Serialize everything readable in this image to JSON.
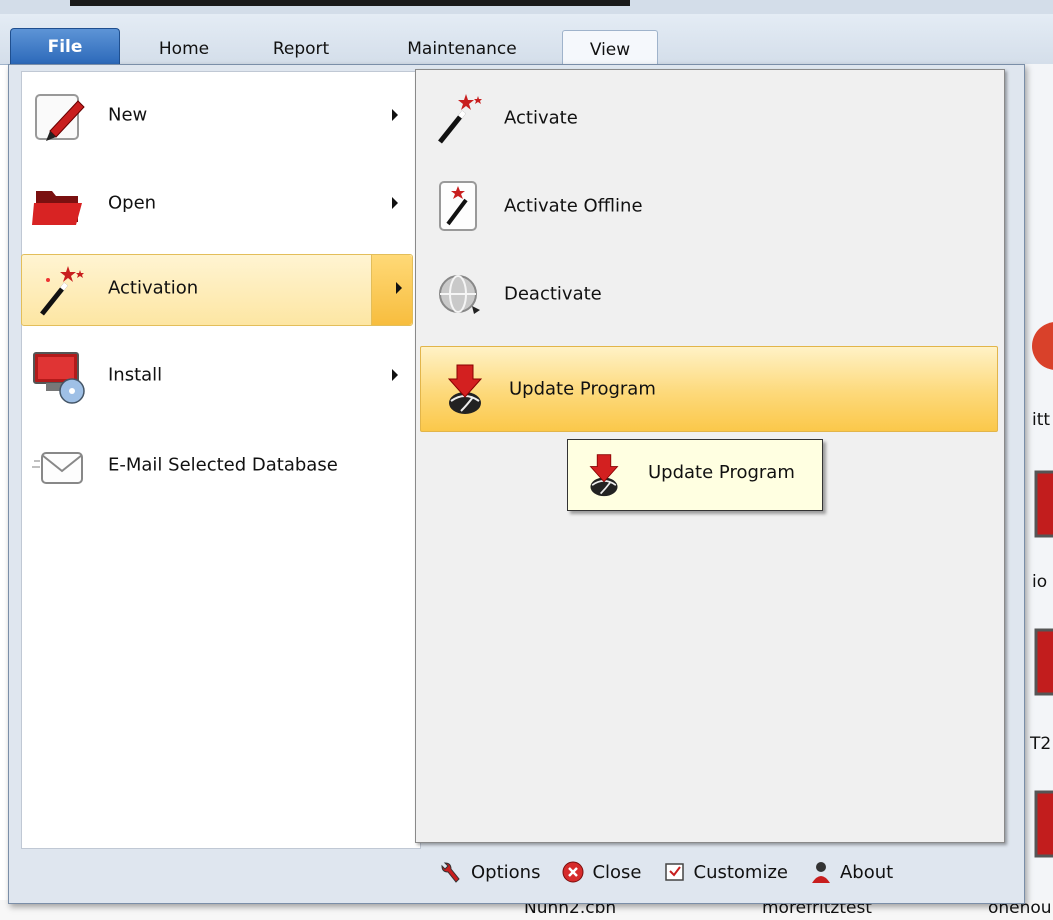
{
  "ribbon": {
    "tabs": [
      {
        "label": "File"
      },
      {
        "label": "Home"
      },
      {
        "label": "Report"
      },
      {
        "label": "Maintenance"
      },
      {
        "label": "View"
      }
    ]
  },
  "file_menu": {
    "left_items": [
      {
        "label": "New",
        "icon": "pencil-icon",
        "has_submenu": true
      },
      {
        "label": "Open",
        "icon": "folder-open-icon",
        "has_submenu": true
      },
      {
        "label": "Activation",
        "icon": "magic-wand-icon",
        "has_submenu": true,
        "active": true
      },
      {
        "label": "Install",
        "icon": "install-disc-icon",
        "has_submenu": true
      },
      {
        "label": "E-Mail Selected Database",
        "icon": "envelope-icon",
        "has_submenu": false
      }
    ],
    "submenu_items": [
      {
        "label": "Activate",
        "icon": "magic-wand-icon"
      },
      {
        "label": "Activate Offline",
        "icon": "wand-card-icon"
      },
      {
        "label": "Deactivate",
        "icon": "globe-gray-icon"
      },
      {
        "label": "Update Program",
        "icon": "update-download-icon",
        "active": true
      }
    ],
    "tooltip": {
      "label": "Update Program",
      "icon": "update-download-icon"
    },
    "footer_buttons": [
      {
        "label": "Options",
        "icon": "wrench-icon"
      },
      {
        "label": "Close",
        "icon": "close-red-icon"
      },
      {
        "label": "Customize",
        "icon": "customize-icon"
      },
      {
        "label": "About",
        "icon": "person-icon"
      }
    ]
  },
  "background": {
    "right_fragments": [
      "itt",
      "io",
      "T2."
    ],
    "bottom_row": [
      "Nunn2.cbh",
      "morefritztest",
      "onehou"
    ]
  },
  "colors": {
    "highlight_light": "#fff2c6",
    "highlight_dark": "#fbc84a",
    "file_tab": "#2b68b9",
    "tooltip_bg": "#ffffe1"
  }
}
